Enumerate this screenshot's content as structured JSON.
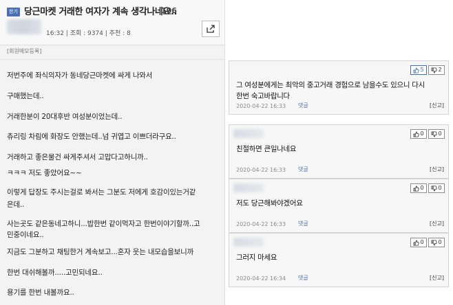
{
  "post": {
    "category_badge": "한기",
    "title": "당근마켓 거래한 여자가 계속 생각나네요..",
    "reply_count": "106",
    "meta": "16:32 | 조회 : 9374 | 추천 : 8",
    "memo_label": "[회원메모등록]",
    "body_lines": [
      "저번주에 좌식의자가 동네당근마켓에 싸게 나와서",
      "구매했는데..",
      "거래한분이 20대후반 여성분이었는데..",
      "츄리링 차림에 화장도 안했는데..넘 귀엽고 이쁘더라구요..",
      "거래하고 좋은물건 싸게주셔서 고맙다고하니까..",
      "ㅋㅋㅋ 저도 좋았어요~~",
      " 이렇게 답장도 주시는걸로 봐서는 그분도 저에게 호감이있는거같",
      "은데..",
      "사는곳도 같은동네고하니...밥한번 같이먹자고 한번이야기할까..고",
      "민중이네요..",
      "지금도 그분하고 채팅한거 계속보고...혼자 웃는 내모습을보니까",
      "한번 대쉬해볼까.....고민되네요..",
      "용기를 한번 내볼까요.."
    ]
  },
  "comments": [
    {
      "text_lines": [
        "그 여성분에게는 최악의 중고거래 경험으로 남을수도 있으니 다시",
        "한번 숙고바랍니다"
      ],
      "date": "2020-04-22 16:33",
      "up": "5",
      "down": "2",
      "reply_label": "댓글",
      "report_label": "[신고]"
    },
    {
      "text_lines": [
        "친절하면 큰일나네요"
      ],
      "date": "2020-04-22 16:33",
      "up": "0",
      "down": "0",
      "reply_label": "댓글",
      "report_label": "[신고]"
    },
    {
      "text_lines": [
        "저도 당근해봐야겠어요"
      ],
      "date": "2020-04-22 16:33",
      "up": "0",
      "down": "0",
      "reply_label": "댓글",
      "report_label": "[신고]"
    },
    {
      "text_lines": [
        "그러지 마세요"
      ],
      "date": "2020-04-22 16:34",
      "up": "0",
      "down": "0",
      "reply_label": "댓글",
      "report_label": "[신고]"
    }
  ],
  "icons": {
    "share": "share-icon",
    "thumbs_up": "thumbs-up-icon",
    "thumbs_down": "thumbs-down-icon"
  },
  "colors": {
    "badge": "#4a6fb5",
    "active_vote": "#3b6fc4"
  }
}
